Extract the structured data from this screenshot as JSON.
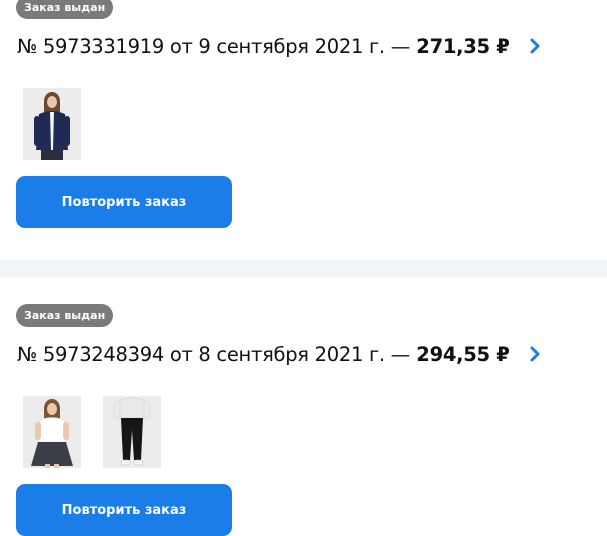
{
  "orders": [
    {
      "status_badge": "Заказ выдан",
      "title_prefix": "№ 5973331919 от 9 сентября 2021 г.",
      "title_dash": "—",
      "price": "271,35 ₽",
      "chevron_icon": "chevron-right-icon",
      "thumbnails": [
        "product-photo"
      ],
      "repeat_label": "Повторить заказ"
    },
    {
      "status_badge": "Заказ выдан",
      "title_prefix": "№ 5973248394 от 8 сентября 2021 г.",
      "title_dash": "—",
      "price": "294,55 ₽",
      "chevron_icon": "chevron-right-icon",
      "thumbnails": [
        "product-photo",
        "product-photo"
      ],
      "repeat_label": "Повторить заказ"
    }
  ],
  "colors": {
    "accent": "#1a7de8",
    "badge_bg": "#7a7a7a",
    "divider": "#f1f5f9",
    "chevron": "#1a7de8"
  }
}
